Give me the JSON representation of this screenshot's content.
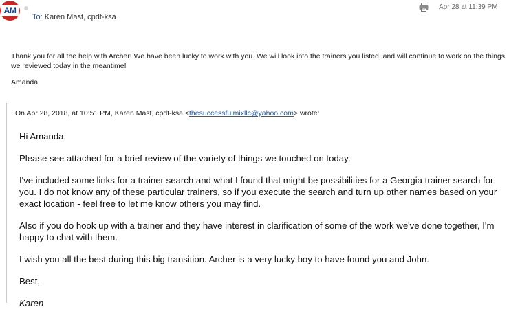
{
  "sender": {
    "initials": "AM",
    "avatar_color": "#c62828",
    "avatar_text_color": "#123c87"
  },
  "header": {
    "to_prefix": "To:",
    "recipients": "Karen Mast, cpdt-ksa",
    "date": "Apr 28 at 11:39 PM",
    "print_icon": "print-icon"
  },
  "message": {
    "body": "Thank you for all the help with Archer! We have been lucky to work with you. We will look into the trainers you listed, and will continue to work on the things we reviewed today in the meantime!",
    "signoff": "Amanda"
  },
  "quoted": {
    "header_prefix": "On Apr 28, 2018, at 10:51 PM, Karen Mast, cpdt-ksa <",
    "email": "thesuccessfulmixllc@yahoo.com",
    "header_suffix": "> wrote:",
    "greeting": "Hi Amanda,",
    "paragraphs": [
      "Please see attached for a brief review of the variety of things we touched on today.",
      "I've included some links for a trainer search and what I found that might be possibilities for a Georgia trainer search for you.  I do not know any of these particular trainers, so if you execute the search and turn up other names based on your exact location - feel free to let me know others you may find.",
      "Also if you do hook up with a trainer and they have interest in clarification of some of the work we've done together, I'm happy to chat with them.",
      "I wish you all the best during this big transition.  Archer is a very lucky boy to have found you and John."
    ],
    "closing": "Best,",
    "signature": "Karen"
  }
}
